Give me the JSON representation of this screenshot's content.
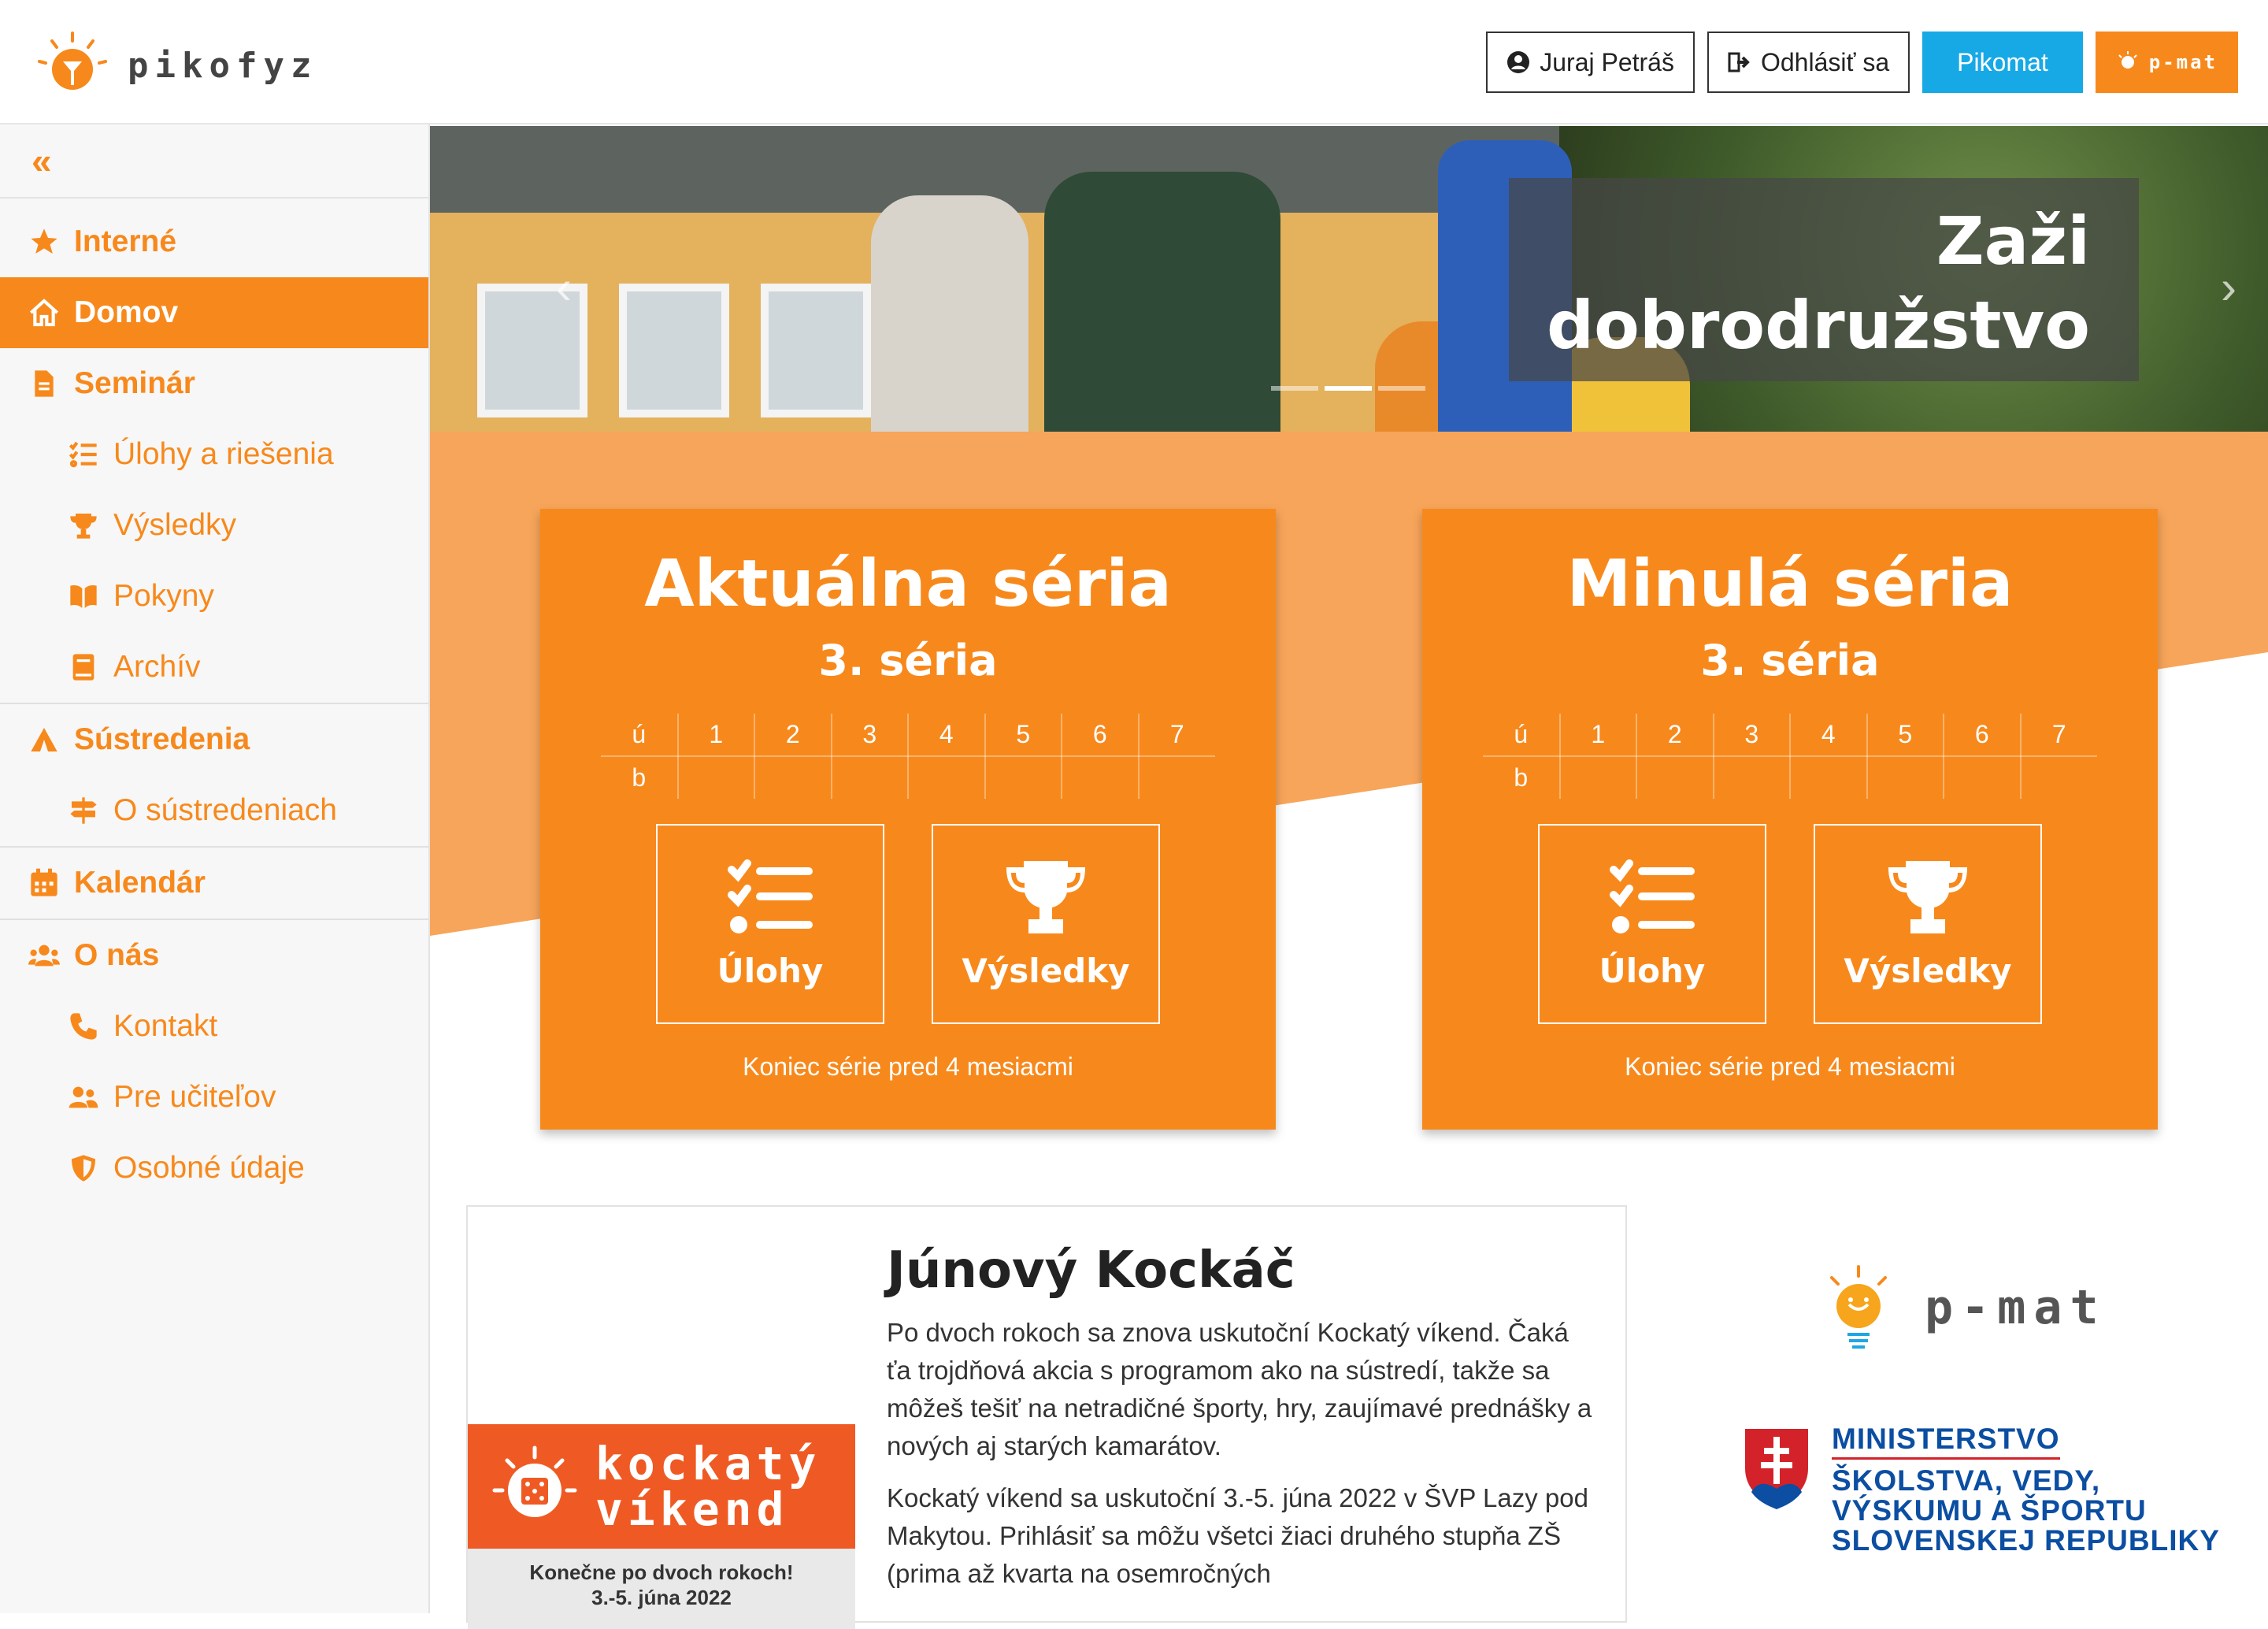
{
  "header": {
    "logo_text": "pikofyz",
    "user_label": "Juraj Petráš",
    "logout_label": "Odhlásiť sa",
    "pikomat_label": "Pikomat",
    "pmat_label": "p-mat"
  },
  "sidebar": {
    "collapse_icon": "chevrons-left-icon",
    "items": [
      {
        "label": "Interné",
        "icon": "star-icon"
      },
      {
        "label": "Domov",
        "icon": "home-icon"
      },
      {
        "label": "Seminár",
        "icon": "file-icon"
      },
      {
        "label": "Úlohy a riešenia",
        "icon": "tasks-icon"
      },
      {
        "label": "Výsledky",
        "icon": "trophy-icon"
      },
      {
        "label": "Pokyny",
        "icon": "book-open-icon"
      },
      {
        "label": "Archív",
        "icon": "book-icon"
      },
      {
        "label": "Sústredenia",
        "icon": "campground-icon"
      },
      {
        "label": "O sústredeniach",
        "icon": "signs-icon"
      },
      {
        "label": "Kalendár",
        "icon": "calendar-icon"
      },
      {
        "label": "O nás",
        "icon": "users-icon"
      },
      {
        "label": "Kontakt",
        "icon": "phone-icon"
      },
      {
        "label": "Pre učiteľov",
        "icon": "user-friends-icon"
      },
      {
        "label": "Osobné údaje",
        "icon": "shield-icon"
      }
    ]
  },
  "hero": {
    "caption_line1": "Zaži",
    "caption_line2": "dobrodružstvo"
  },
  "cards": [
    {
      "title": "Aktuálna séria",
      "subtitle": "3. séria",
      "header_row": [
        "ú",
        "1",
        "2",
        "3",
        "4",
        "5",
        "6",
        "7"
      ],
      "second_row_label": "b",
      "tasks_label": "Úlohy",
      "results_label": "Výsledky",
      "footer": "Koniec série pred 4 mesiacmi"
    },
    {
      "title": "Minulá séria",
      "subtitle": "3. séria",
      "header_row": [
        "ú",
        "1",
        "2",
        "3",
        "4",
        "5",
        "6",
        "7"
      ],
      "second_row_label": "b",
      "tasks_label": "Úlohy",
      "results_label": "Výsledky",
      "footer": "Koniec série pred 4 mesiacmi"
    }
  ],
  "article": {
    "title": "Júnový Kockáč",
    "p1": "Po dvoch rokoch sa znova uskutoční Kockatý víkend. Čaká ťa trojdňová akcia s programom ako na sústredí, takže sa môžeš tešiť na netradičné športy, hry, zaujímavé prednášky a nových aj starých kamarátov.",
    "p2": "Kockatý víkend sa uskutoční 3.-5. júna 2022 v ŠVP Lazy pod Makytou. Prihlásiť sa môžu všetci žiaci druhého stupňa ZŠ (prima až kvarta na osemročných",
    "image_line1": "kockatý",
    "image_line2": "víkend",
    "image_sub1": "Konečne po dvoch rokoch!",
    "image_sub2": "3.-5. júna 2022"
  },
  "sponsors": {
    "pmat_text": "p-mat",
    "ministry_line1": "MINISTERSTVO",
    "ministry_line2": "ŠKOLSTVA, VEDY,",
    "ministry_line3": "VÝSKUMU A ŠPORTU",
    "ministry_line4": "SLOVENSKEJ REPUBLIKY"
  },
  "colors": {
    "accent": "#f7891c",
    "cyan": "#17a9e6",
    "kockaty": "#ef5a24",
    "ministry_blue": "#0b4ea2"
  }
}
